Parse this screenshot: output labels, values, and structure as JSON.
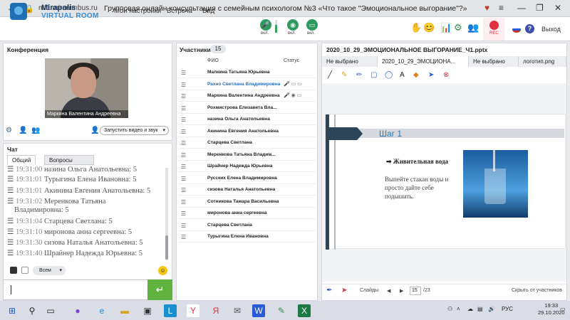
{
  "browser": {
    "url": "mf1.miranimbus.ru",
    "title": "Групповая онлайн консультация с семейным психологом №3 «Что такое \"Эмоциональное выгорание\"?»"
  },
  "app": {
    "logo_line1": "Mirapolis",
    "logo_line2": "VIRTUAL ROOM",
    "menu": [
      "Мои настройки",
      "Встреча",
      "Вид"
    ],
    "device_state": "вкл.",
    "rec_label": "REC",
    "exit_label": "Выход",
    "help_label": "?"
  },
  "conference": {
    "title": "Конференция",
    "video_name": "Маркина Валентина Андреевна",
    "start_button": "Запустить видео и звук"
  },
  "chat": {
    "title": "Чат",
    "tabs": [
      "Общий",
      "Вопросы"
    ],
    "messages": [
      {
        "time": "19:31:00",
        "text": "назина Ольга Анатольевна: 5"
      },
      {
        "time": "19:31:01",
        "text": "Турыгина Елена Ивановна: 5"
      },
      {
        "time": "19:31:01",
        "text": "Акинина Евгения Анатольевна: 5"
      },
      {
        "time": "19:31:02",
        "text": "Меренкова Татьяна"
      },
      {
        "time": "",
        "text": "Владимировна: 5"
      },
      {
        "time": "19:31:04",
        "text": "Старцева Светлана: 5"
      },
      {
        "time": "19:31:10",
        "text": "миронова анна сергеевна: 5"
      },
      {
        "time": "19:31:30",
        "text": "сизова Наталья Анатольевна: 5"
      },
      {
        "time": "19:31:40",
        "text": "Шрайнер Надежда Юрьевна: 5"
      }
    ],
    "recipient": "Всем",
    "input_value": ""
  },
  "participants": {
    "title": "Участники",
    "count": "15",
    "col_name": "ФИО",
    "col_status": "Статус",
    "list": [
      "Малкина Татьяна Юрьевна",
      "Рахно Светлана Владимировна",
      "Маркина Валентина Андреевна",
      "Рохмистрова Елизавета Вла...",
      "назина Ольга Анатольевна",
      "Акинина Евгения Анатольевна",
      "Старцева Светлана",
      "Меренкова Татьяна Владим...",
      "Шрайнер Надежда Юрьевна",
      "Русских Елена Владимировна",
      "сизова Наталья Анатольевна",
      "Сотникова Тамара Васильевна",
      "миронова анна сергеевна",
      "Старцева Светлана",
      "Турыгина Елена Ивановна"
    ]
  },
  "presentation": {
    "title": "2020_10_29_ЭМОЦИОНАЛЬНОЕ ВЫГОРАНИЕ_Ч1.pptx",
    "tabs": [
      "Не выбрано",
      "2020_10_29_ЭМОЦИОНА...",
      "Не выбрано",
      "логотип.png"
    ],
    "slide_title": "Шаг 1",
    "slide_subtitle": "Живительная вода",
    "slide_body": "Выпейте стакан воды и просто дайте себе подышать.",
    "slides_label": "Слайды",
    "page": "15",
    "total": "/23",
    "hide_label": "Скрыть от участников"
  },
  "taskbar": {
    "lang": "РУС",
    "time": "19:33",
    "date": "29.10.2020"
  }
}
